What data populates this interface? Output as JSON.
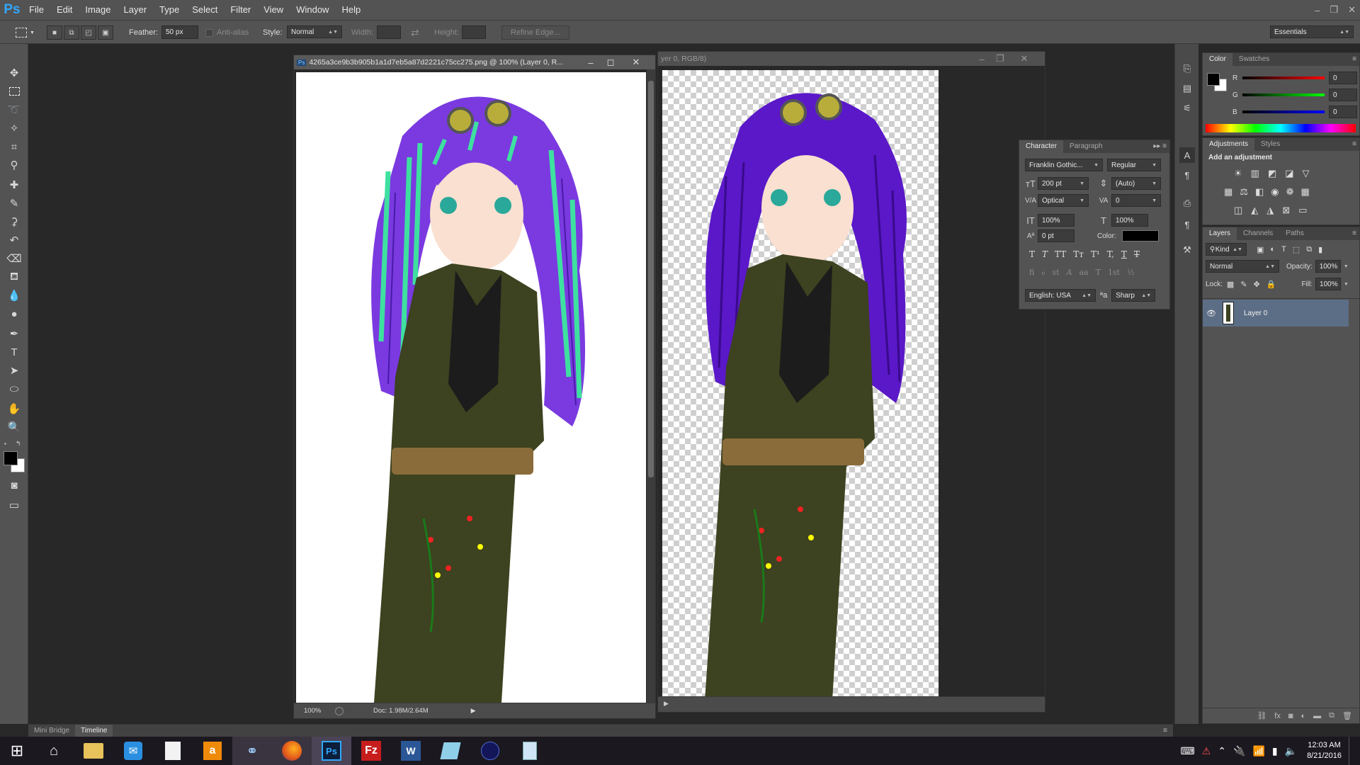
{
  "app": {
    "logo": "Ps"
  },
  "menu": [
    "File",
    "Edit",
    "Image",
    "Layer",
    "Type",
    "Select",
    "Filter",
    "View",
    "Window",
    "Help"
  ],
  "window_controls": {
    "minimize": "–",
    "restore": "❐",
    "close": "✕"
  },
  "options": {
    "feather_label": "Feather:",
    "feather_value": "50 px",
    "antialias_label": "Anti-alias",
    "style_label": "Style:",
    "style_value": "Normal",
    "width_label": "Width:",
    "height_label": "Height:",
    "refine_edge": "Refine Edge...",
    "workspace": "Essentials"
  },
  "doc1": {
    "title": "4265a3ce9b3b905b1a1d7eb5a87d2221c75cc275.png @ 100% (Layer 0, R...",
    "zoom": "100%",
    "doc_size": "Doc: 1.98M/2.64M"
  },
  "doc2": {
    "title": "yer 0, RGB/8)"
  },
  "bottom_tabs": [
    "Mini Bridge",
    "Timeline"
  ],
  "color_panel": {
    "tabs": [
      "Color",
      "Swatches"
    ],
    "r_label": "R",
    "r_value": "0",
    "g_label": "G",
    "g_value": "0",
    "b_label": "B",
    "b_value": "0",
    "fg_color": "#000000",
    "bg_color": "#ffffff"
  },
  "adjustments_panel": {
    "tabs": [
      "Adjustments",
      "Styles"
    ],
    "heading": "Add an adjustment"
  },
  "character_panel": {
    "tabs": [
      "Character",
      "Paragraph"
    ],
    "font_family": "Franklin Gothic...",
    "font_style": "Regular",
    "font_size": "200 pt",
    "leading": "(Auto)",
    "kerning": "Optical",
    "tracking": "0",
    "vertical_scale": "100%",
    "horizontal_scale": "100%",
    "baseline_shift": "0 pt",
    "color_label": "Color:",
    "color": "#000000",
    "language": "English: USA",
    "aa_label": "ªa",
    "antialias": "Sharp",
    "style_buttons": [
      "T",
      "T",
      "TT",
      "Tт",
      "T¹",
      "T,",
      "T",
      "T"
    ],
    "opentype_buttons": [
      "fi",
      "ℴ",
      "st",
      "A",
      "aa",
      "T",
      "1st",
      "½"
    ]
  },
  "layers_panel": {
    "tabs": [
      "Layers",
      "Channels",
      "Paths"
    ],
    "kind_label": "Kind",
    "blend_mode": "Normal",
    "opacity_label": "Opacity:",
    "opacity_value": "100%",
    "lock_label": "Lock:",
    "fill_label": "Fill:",
    "fill_value": "100%",
    "layers": [
      {
        "name": "Layer 0",
        "visible": true,
        "selected": true
      }
    ]
  },
  "taskbar": {
    "time": "12:03 AM",
    "date": "8/21/2016",
    "apps": [
      "windows-start",
      "home",
      "file-explorer",
      "mail",
      "document",
      "amazon",
      "network-app",
      "firefox",
      "photoshop",
      "filezilla",
      "word",
      "notepad-app",
      "media-app",
      "calculator"
    ]
  }
}
